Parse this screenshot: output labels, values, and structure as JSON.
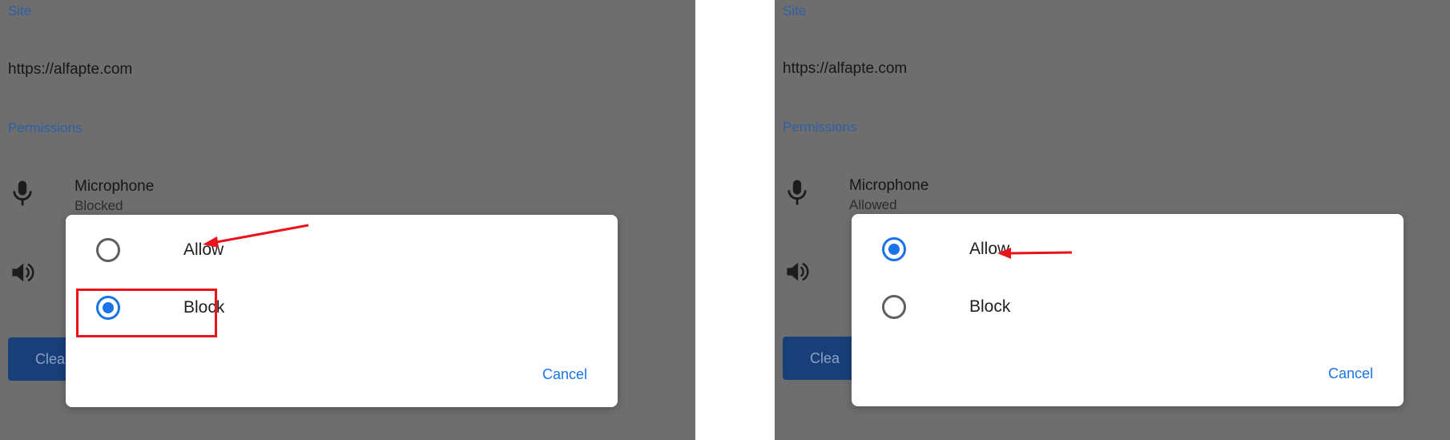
{
  "panels": [
    {
      "site_label": "Site",
      "site_url": "https://alfapte.com",
      "permissions_label": "Permissions",
      "microphone": {
        "title": "Microphone",
        "status": "Blocked",
        "icon": "microphone-icon"
      },
      "sound_icon": "speaker-icon",
      "clear_button": "Clea",
      "dialog": {
        "options": [
          {
            "label": "Allow",
            "selected": false
          },
          {
            "label": "Block",
            "selected": true
          }
        ],
        "cancel_label": "Cancel"
      }
    },
    {
      "site_label": "Site",
      "site_url": "https://alfapte.com",
      "permissions_label": "Permissions",
      "microphone": {
        "title": "Microphone",
        "status": "Allowed",
        "icon": "microphone-icon"
      },
      "sound_icon": "speaker-icon",
      "clear_button": "Clea",
      "dialog": {
        "options": [
          {
            "label": "Allow",
            "selected": true
          },
          {
            "label": "Block",
            "selected": false
          }
        ],
        "cancel_label": "Cancel"
      }
    }
  ],
  "colors": {
    "accent": "#1a73e8",
    "annotation": "#e8131b",
    "scrim": "#6e6e6e"
  }
}
